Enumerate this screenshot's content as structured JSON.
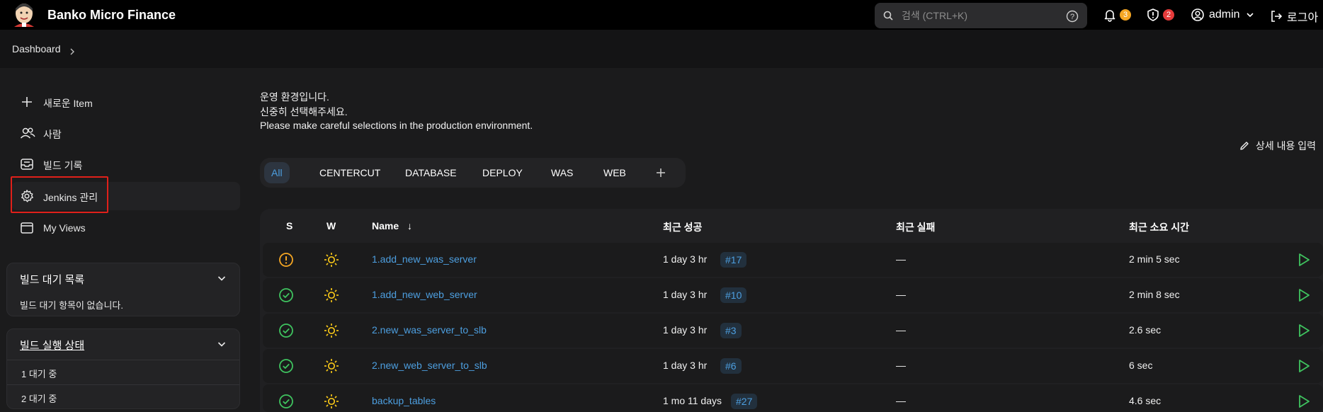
{
  "header": {
    "app_title": "Banko Micro Finance",
    "search_placeholder": "검색 (CTRL+K)",
    "notifications_count": "3",
    "security_count": "2",
    "user": "admin",
    "logout": "로그아"
  },
  "breadcrumb": {
    "root": "Dashboard"
  },
  "sidebar": {
    "items": [
      {
        "label": "새로운 Item",
        "icon": "plus-icon"
      },
      {
        "label": "사람",
        "icon": "people-icon"
      },
      {
        "label": "빌드 기록",
        "icon": "inbox-icon"
      },
      {
        "label": "Jenkins 관리",
        "icon": "gear-icon"
      },
      {
        "label": "My Views",
        "icon": "window-icon"
      }
    ],
    "queue": {
      "title": "빌드 대기 목록",
      "empty": "빌드 대기 항목이 없습니다."
    },
    "executors": {
      "title": "빌드 실행 상태",
      "items": [
        "1  대기 중",
        "2  대기 중"
      ]
    }
  },
  "main": {
    "description": [
      "운영 환경입니다.",
      "신중히 선택해주세요.",
      "Please make careful selections in the production environment."
    ],
    "edit_description": "상세 내용 입력",
    "tabs": [
      "All",
      "CENTERCUT",
      "DATABASE",
      "DEPLOY",
      "WAS",
      "WEB"
    ],
    "table": {
      "headers": {
        "s": "S",
        "w": "W",
        "name": "Name",
        "sort": "↓",
        "last_success": "최근 성공",
        "last_failure": "최근 실패",
        "last_duration": "최근 소요 시간"
      },
      "rows": [
        {
          "status": "warning",
          "name": "1.add_new_was_server",
          "last_success": "1 day 3 hr",
          "build": "#17",
          "last_failure": "—",
          "duration": "2 min 5 sec"
        },
        {
          "status": "success",
          "name": "1.add_new_web_server",
          "last_success": "1 day 3 hr",
          "build": "#10",
          "last_failure": "—",
          "duration": "2 min 8 sec"
        },
        {
          "status": "success",
          "name": "2.new_was_server_to_slb",
          "last_success": "1 day 3 hr",
          "build": "#3",
          "last_failure": "—",
          "duration": "2.6 sec"
        },
        {
          "status": "success",
          "name": "2.new_web_server_to_slb",
          "last_success": "1 day 3 hr",
          "build": "#6",
          "last_failure": "—",
          "duration": "6 sec"
        },
        {
          "status": "success",
          "name": "backup_tables",
          "last_success": "1 mo 11 days",
          "build": "#27",
          "last_failure": "—",
          "duration": "4.6 sec"
        }
      ]
    }
  },
  "colors": {
    "accent": "#4d9fe0",
    "success": "#3fc35f",
    "warning": "#f5a623",
    "weather": "#f5c518"
  }
}
